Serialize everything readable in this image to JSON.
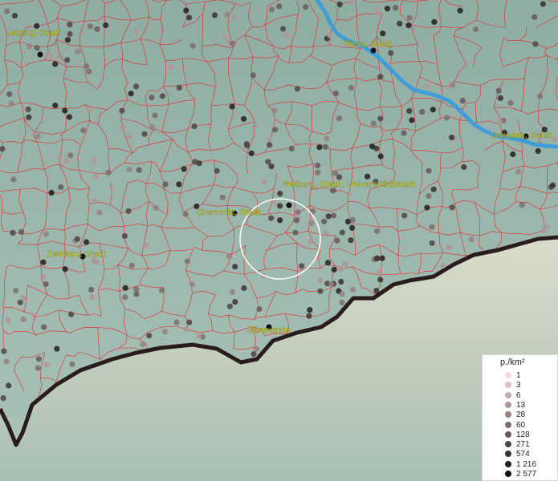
{
  "labels": [
    {
      "name": "Leipzig, Stadt"
    },
    {
      "name": "Riesa, Stadt"
    },
    {
      "name": "Dresden, Stadt"
    },
    {
      "name": "Freiberg, Stadt, Universitätsstadt"
    },
    {
      "name": "Chemnitz, Stadt"
    },
    {
      "name": "Zwickau, Stadt"
    },
    {
      "name": "Bärenstein"
    }
  ],
  "legend": {
    "title": "p./km²",
    "items": [
      {
        "label": "1",
        "color": "#eedcdc"
      },
      {
        "label": "3",
        "color": "#d8c2c2"
      },
      {
        "label": "6",
        "color": "#c4abab"
      },
      {
        "label": "13",
        "color": "#ad9595"
      },
      {
        "label": "28",
        "color": "#958181"
      },
      {
        "label": "60",
        "color": "#7e6d6d"
      },
      {
        "label": "128",
        "color": "#675959"
      },
      {
        "label": "271",
        "color": "#504545"
      },
      {
        "label": "574",
        "color": "#3a3131"
      },
      {
        "label": "1 216",
        "color": "#231d1d"
      },
      {
        "label": "2 577",
        "color": "#0d0a0a"
      }
    ]
  },
  "colors": {
    "border": "#e8262a",
    "river": "#3f9ed8",
    "label_text": "#e7e600",
    "state_border": "#2a1c1c"
  }
}
